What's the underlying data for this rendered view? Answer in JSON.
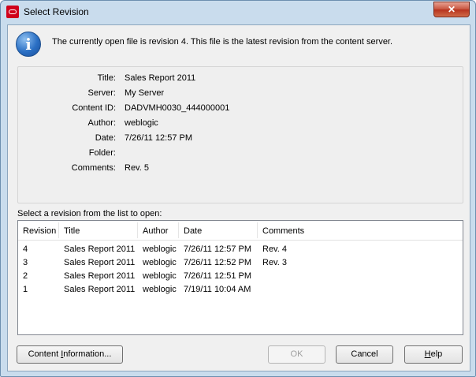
{
  "window": {
    "title": "Select Revision",
    "close_glyph": "✕",
    "app_icon": "oracle-logo-icon"
  },
  "message": {
    "icon": "info-icon",
    "icon_glyph": "i",
    "text": "The currently open file is revision 4.  This file is the latest revision from the content server."
  },
  "details": [
    {
      "label": "Title:",
      "value": "Sales Report 2011"
    },
    {
      "label": "Server:",
      "value": "My Server"
    },
    {
      "label": "Content ID:",
      "value": "DADVMH0030_444000001"
    },
    {
      "label": "Author:",
      "value": "weblogic"
    },
    {
      "label": "Date:",
      "value": "7/26/11 12:57 PM"
    },
    {
      "label": "Folder:",
      "value": ""
    },
    {
      "label": "Comments:",
      "value": "Rev. 5"
    }
  ],
  "list": {
    "caption": "Select a revision from the list to open:",
    "columns": [
      "Revision",
      "Title",
      "Author",
      "Date",
      "Comments"
    ],
    "rows": [
      [
        "4",
        "Sales Report 2011",
        "weblogic",
        "7/26/11 12:57 PM",
        "Rev. 4"
      ],
      [
        "3",
        "Sales Report 2011",
        "weblogic",
        "7/26/11 12:52 PM",
        "Rev. 3"
      ],
      [
        "2",
        "Sales Report 2011",
        "weblogic",
        "7/26/11 12:51 PM",
        ""
      ],
      [
        "1",
        "Sales Report 2011",
        "weblogic",
        "7/19/11 10:04 AM",
        ""
      ]
    ]
  },
  "buttons": {
    "content_info_pre": "Content ",
    "content_info_u": "I",
    "content_info_post": "nformation...",
    "ok": "OK",
    "cancel": "Cancel",
    "help_u": "H",
    "help_post": "elp"
  }
}
